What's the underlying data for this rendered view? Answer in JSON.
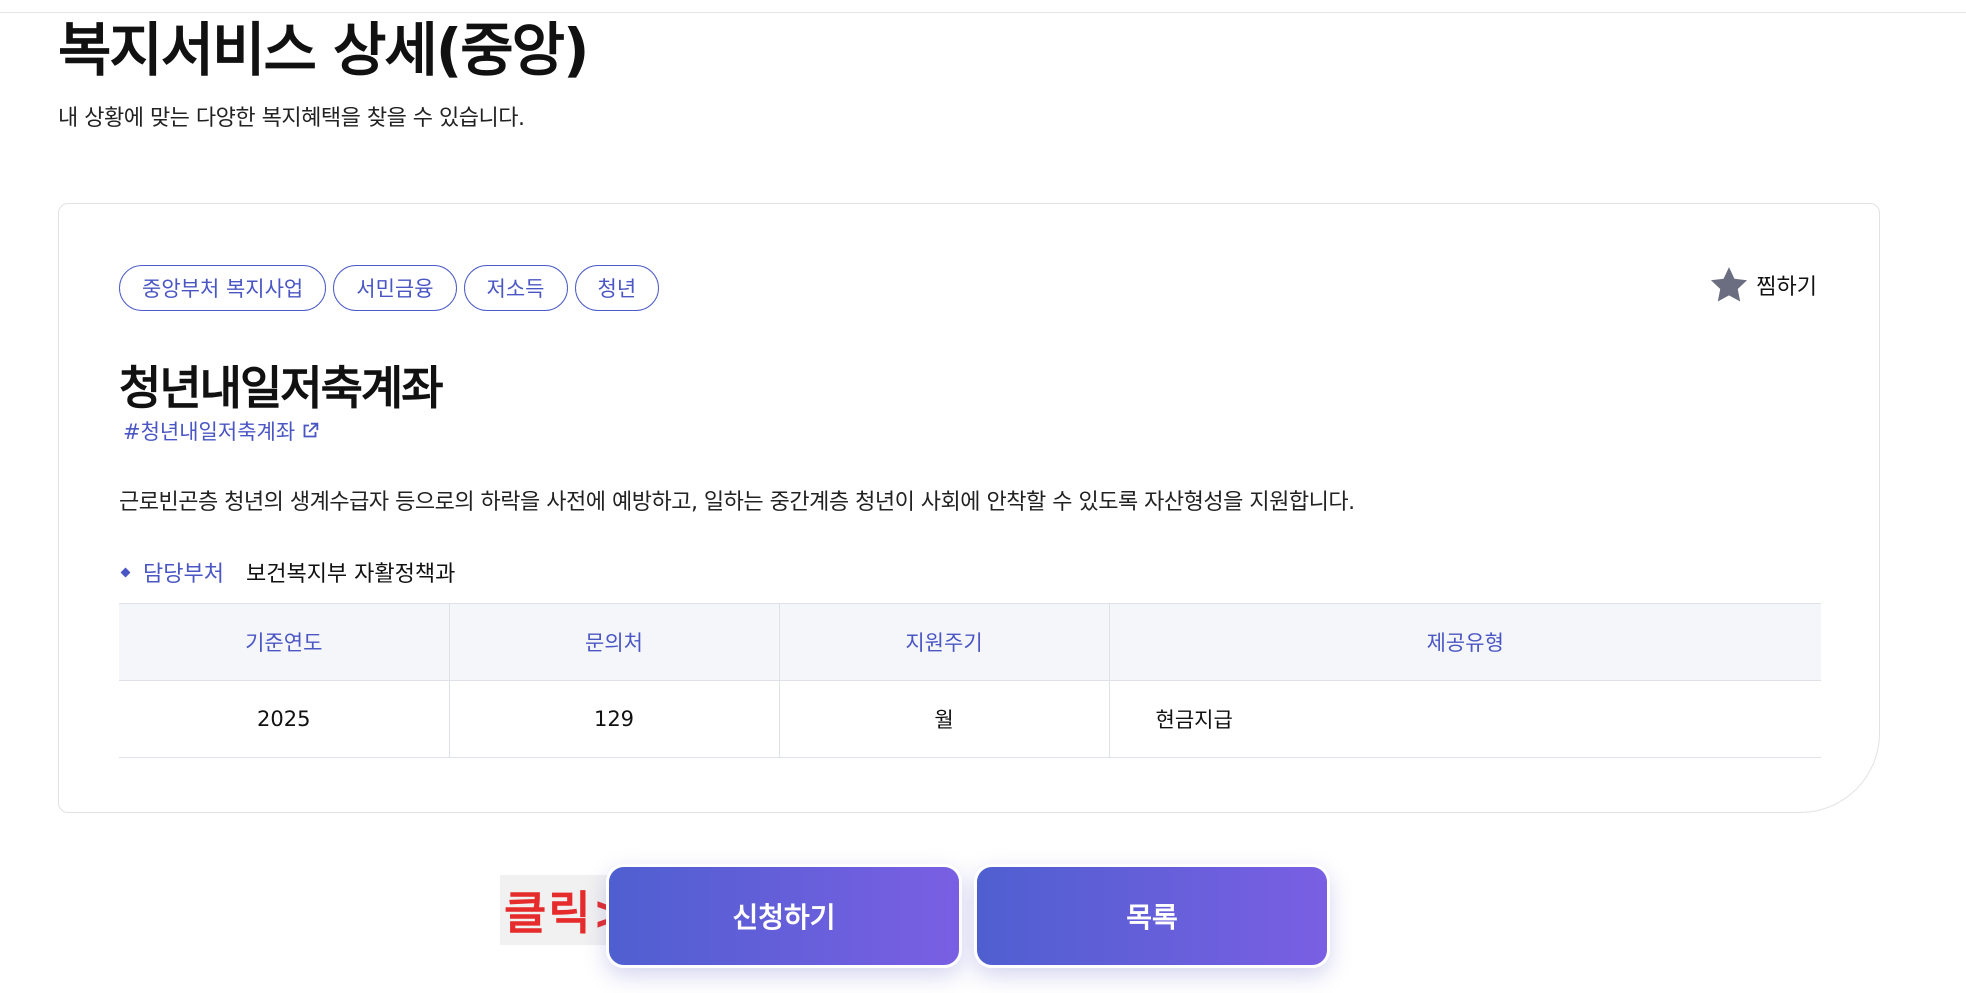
{
  "header": {
    "title": "복지서비스 상세(중앙)",
    "subtitle": "내 상황에 맞는 다양한 복지혜택을 찾을 수 있습니다."
  },
  "tags": [
    "중앙부처 복지사업",
    "서민금융",
    "저소득",
    "청년"
  ],
  "bookmark": {
    "label": "찜하기",
    "icon": "star-icon",
    "color": "#6b6d80"
  },
  "service": {
    "title": "청년내일저축계좌",
    "hashtag": "#청년내일저축계좌",
    "description": "근로빈곤층 청년의 생계수급자 등으로의 하락을 사전에 예방하고, 일하는 중간계층 청년이 사회에 안착할 수 있도록 자산형성을 지원합니다."
  },
  "department": {
    "label": "담당부처",
    "value": "보건복지부 자활정책과"
  },
  "info_table": {
    "headers": [
      "기준연도",
      "문의처",
      "지원주기",
      "제공유형"
    ],
    "row": [
      "2025",
      "129",
      "월",
      "현금지급"
    ]
  },
  "click_hint": "클릭>>",
  "buttons": {
    "apply": "신청하기",
    "list": "목록"
  },
  "colors": {
    "accent": "#4a56c4",
    "button_gradient_start": "#4f5fd0",
    "button_gradient_end": "#7a5fe3",
    "hint": "#e52b2b"
  }
}
